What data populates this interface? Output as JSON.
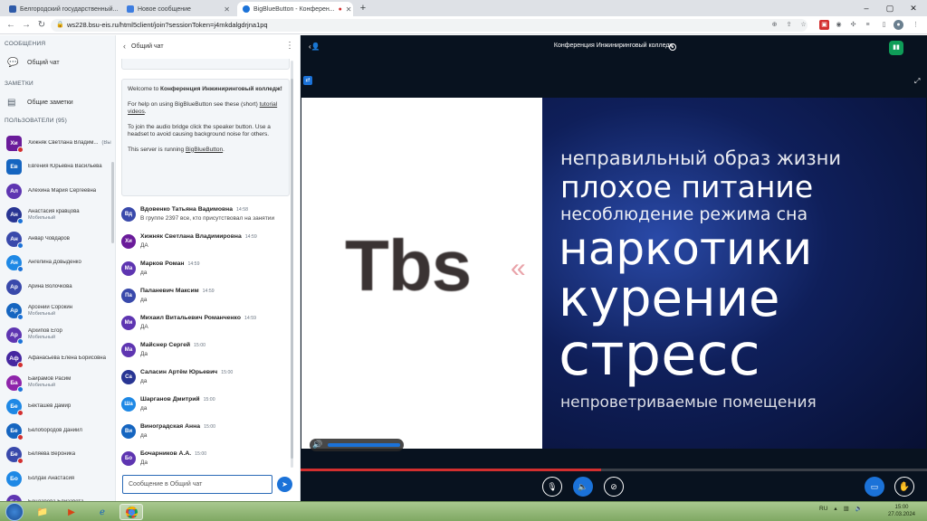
{
  "browser": {
    "tabs": [
      {
        "title": "Белгородский государственный...",
        "fav_color": "#2e5aa8"
      },
      {
        "title": "Новое сообщение",
        "fav_color": "#3d7de0"
      },
      {
        "title": "BigBlueButton - Конферен...",
        "fav_color": "#1b72d8"
      }
    ],
    "new_tab": "+",
    "url": "ws228.bsu-eis.ru/html5client/join?sessionToken=j4mkdalgdrjna1pq",
    "win_min": "–",
    "win_max": "▢",
    "win_close": "✕"
  },
  "sidebar": {
    "messages_heading": "СООБЩЕНИЯ",
    "public_chat": "Общий чат",
    "notes_heading": "ЗАМЕТКИ",
    "shared_notes": "Общие заметки",
    "users_heading": "ПОЛЬЗОВАТЕЛИ (95)",
    "users": [
      {
        "initials": "Хи",
        "name": "Хижняк Светлана Владим...",
        "me": "(Вы)",
        "sub": "",
        "color": "#6a1b9a",
        "dot": "#d32f2f",
        "square": true
      },
      {
        "initials": "Ев",
        "name": "Евгения Юрьевна Васильева",
        "me": "",
        "sub": "",
        "color": "#1565c0",
        "dot": "",
        "square": true
      },
      {
        "initials": "Ал",
        "name": "Алёхина Мария Сергеевна",
        "me": "",
        "sub": "",
        "color": "#5e35b1",
        "dot": "",
        "square": false
      },
      {
        "initials": "Ан",
        "name": "Анастасия кравцова",
        "me": "",
        "sub": "Мобильный",
        "color": "#283593",
        "dot": "#1b72d8",
        "square": false
      },
      {
        "initials": "Ан",
        "name": "Анвар Човдаров",
        "me": "",
        "sub": "",
        "color": "#3949ab",
        "dot": "#1b72d8",
        "square": false
      },
      {
        "initials": "Ан",
        "name": "Ангелина Довыденко",
        "me": "",
        "sub": "",
        "color": "#1e88e5",
        "dot": "#1b72d8",
        "square": false
      },
      {
        "initials": "Ар",
        "name": "Арина Волочкова",
        "me": "",
        "sub": "",
        "color": "#3949ab",
        "dot": "",
        "square": false
      },
      {
        "initials": "Ар",
        "name": "Арсений Сорокин",
        "me": "",
        "sub": "Мобильный",
        "color": "#1565c0",
        "dot": "#1b72d8",
        "square": false
      },
      {
        "initials": "Ар",
        "name": "Архипов Егор",
        "me": "",
        "sub": "Мобильный",
        "color": "#5e35b1",
        "dot": "#1b72d8",
        "square": false
      },
      {
        "initials": "Аф",
        "name": "Афанасьева Елена Борисовна",
        "me": "",
        "sub": "",
        "color": "#4527a0",
        "dot": "#d32f2f",
        "square": false
      },
      {
        "initials": "Ба",
        "name": "Байрамов Расим",
        "me": "",
        "sub": "Мобильный",
        "color": "#8e24aa",
        "dot": "#1b72d8",
        "square": false
      },
      {
        "initials": "Бе",
        "name": "Бекташев Дамир",
        "me": "",
        "sub": "",
        "color": "#1e88e5",
        "dot": "#d32f2f",
        "square": false
      },
      {
        "initials": "Бе",
        "name": "Белобородов Даниил",
        "me": "",
        "sub": "",
        "color": "#1565c0",
        "dot": "#d32f2f",
        "square": false
      },
      {
        "initials": "Бе",
        "name": "Беляева Вероника",
        "me": "",
        "sub": "",
        "color": "#3949ab",
        "dot": "#d32f2f",
        "square": false
      },
      {
        "initials": "Бо",
        "name": "Болдак Анастасия",
        "me": "",
        "sub": "",
        "color": "#1e88e5",
        "dot": "",
        "square": false
      },
      {
        "initials": "Бо",
        "name": "Бондарева Елизавета",
        "me": "",
        "sub": "",
        "color": "#5e35b1",
        "dot": "",
        "square": false
      }
    ]
  },
  "chat": {
    "title": "Общий чат",
    "back": "‹",
    "menu": "⋮",
    "welcome_prefix": "Welcome to",
    "welcome_name": "Конференция Инжиниринговый колледж",
    "welcome_suffix": "!",
    "help_text": "For help on using BigBlueButton see these (short)",
    "help_link": "tutorial videos",
    "help_end": ".",
    "audio_text": "To join the audio bridge click the speaker button. Use a headset to avoid causing background noise for others.",
    "server_text": "This server is running",
    "server_link": "BigBlueButton",
    "server_end": ".",
    "messages": [
      {
        "initials": "Вд",
        "name": "Вдовенко Татьяна Вадимовна",
        "time": "14:58",
        "text": "В группе 2397 все, кто присутствовал на занятии",
        "color": "#3949ab"
      },
      {
        "initials": "Хи",
        "name": "Хижняк Светлана Владимировна",
        "time": "14:59",
        "text": "ДА",
        "color": "#6a1b9a"
      },
      {
        "initials": "Ма",
        "name": "Марков Роман",
        "time": "14:59",
        "text": "да",
        "color": "#5e35b1"
      },
      {
        "initials": "Па",
        "name": "Паланевич Максим",
        "time": "14:59",
        "text": "да",
        "color": "#3949ab"
      },
      {
        "initials": "Ми",
        "name": "Михаил Витальевич Романченко",
        "time": "14:59",
        "text": "ДА",
        "color": "#5e35b1"
      },
      {
        "initials": "Ма",
        "name": "Майснер Сергей",
        "time": "15:00",
        "text": "Да",
        "color": "#5e35b1"
      },
      {
        "initials": "Са",
        "name": "Саласин Артём Юрьевич",
        "time": "15:00",
        "text": "да",
        "color": "#283593"
      },
      {
        "initials": "Ша",
        "name": "Шарганов Дмитрий",
        "time": "15:00",
        "text": "да",
        "color": "#1e88e5"
      },
      {
        "initials": "Ви",
        "name": "Виноградская Анна",
        "time": "15:00",
        "text": "да",
        "color": "#1565c0"
      },
      {
        "initials": "Бо",
        "name": "Бочарников А.А.",
        "time": "15:00",
        "text": "Да",
        "color": "#5e35b1"
      }
    ],
    "input_placeholder": "Сообщение в Общий чат",
    "send": "➤"
  },
  "conference": {
    "title": "Конференция Инжиниринговый колледж",
    "slide": {
      "logo_text": "Tbs",
      "logo_mark": "«",
      "lines": [
        "неправильный образ жизни",
        "плохое питание",
        "несоблюдение режима сна",
        "наркотики",
        "курение",
        "стресс",
        "непроветриваемые помещения"
      ]
    },
    "progress_fraction": 0.48
  },
  "taskbar": {
    "lang": "RU",
    "time": "15:00",
    "date": "27.03.2024"
  }
}
